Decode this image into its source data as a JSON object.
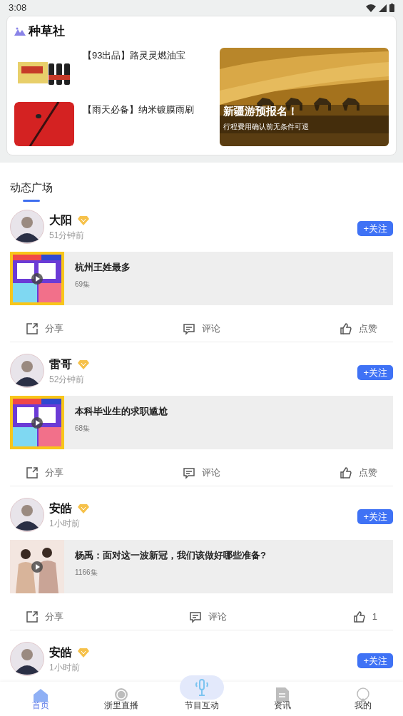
{
  "status_bar": {
    "time": "3:08"
  },
  "featured": {
    "title": "种草社",
    "items": [
      {
        "title": "【93出品】路灵灵燃油宝",
        "kind": "bottles"
      },
      {
        "title": "【雨天必备】纳米镀膜雨刷",
        "kind": "wiper"
      }
    ],
    "banner": {
      "title": "新疆游预报名！",
      "subtitle": "行程费用确认前无条件可退"
    }
  },
  "feed": {
    "title": "动态广场",
    "posts": [
      {
        "name": "大阳",
        "time": "51分钟前",
        "follow": "+关注",
        "episode": {
          "title": "杭州王姓最多",
          "count": "69集",
          "kind": "poster"
        },
        "actions": [
          {
            "kind": "share",
            "label": "分享"
          },
          {
            "kind": "comment",
            "label": "评论"
          },
          {
            "kind": "like",
            "label": "点赞"
          }
        ]
      },
      {
        "name": "雷哥",
        "time": "52分钟前",
        "follow": "+关注",
        "episode": {
          "title": "本科毕业生的求职尴尬",
          "count": "68集",
          "kind": "poster"
        },
        "actions": [
          {
            "kind": "share",
            "label": "分享"
          },
          {
            "kind": "comment",
            "label": "评论"
          },
          {
            "kind": "like",
            "label": "点赞"
          }
        ]
      },
      {
        "name": "安皓",
        "time": "1小时前",
        "follow": "+关注",
        "episode": {
          "title": "杨禹：面对这一波新冠，我们该做好哪些准备?",
          "count": "1166集",
          "kind": "people"
        },
        "actions": [
          {
            "kind": "share",
            "label": "分享"
          },
          {
            "kind": "comment",
            "label": "评论"
          },
          {
            "kind": "like",
            "label": "1"
          }
        ]
      },
      {
        "name": "安皓",
        "time": "1小时前",
        "follow": "+关注"
      }
    ]
  },
  "nav": [
    {
      "label": "首页",
      "kind": "home",
      "selected": true
    },
    {
      "label": "浙里直播",
      "kind": "reel",
      "selected": false
    },
    {
      "label": "节目互动",
      "kind": "mic",
      "selected": false
    },
    {
      "label": "资讯",
      "kind": "doc",
      "selected": false
    },
    {
      "label": "我的",
      "kind": "user",
      "selected": false
    }
  ]
}
